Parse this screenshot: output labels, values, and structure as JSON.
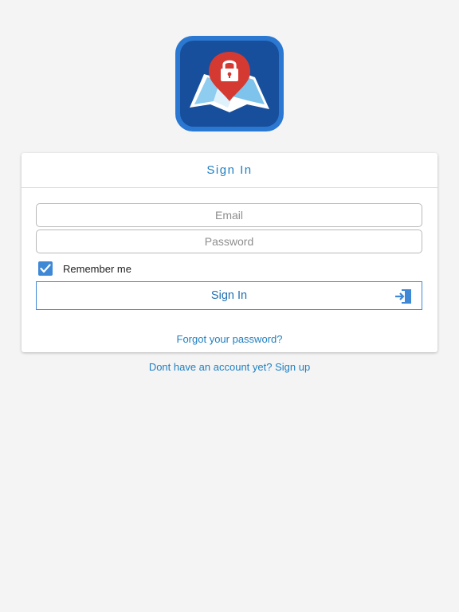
{
  "logo": {
    "icon": "map-lock-icon",
    "colors": {
      "frame": "#2a78d2",
      "inner": "#174f9c",
      "pin": "#d43a32",
      "map": "#e8f4fb",
      "map_shade": "#7ec3ec"
    }
  },
  "card": {
    "title": "Sign In",
    "email_placeholder": "Email",
    "password_placeholder": "Password",
    "remember_label": "Remember me",
    "remember_checked": true,
    "sign_in_label": "Sign In",
    "sign_in_icon": "login-door-icon",
    "forgot_password": "Forgot your password?"
  },
  "signup": {
    "text": "Dont have an account yet? Sign up"
  },
  "colors": {
    "accent": "#1f7fc1",
    "background": "#f4f4f4",
    "checkbox": "#3f88d6"
  }
}
